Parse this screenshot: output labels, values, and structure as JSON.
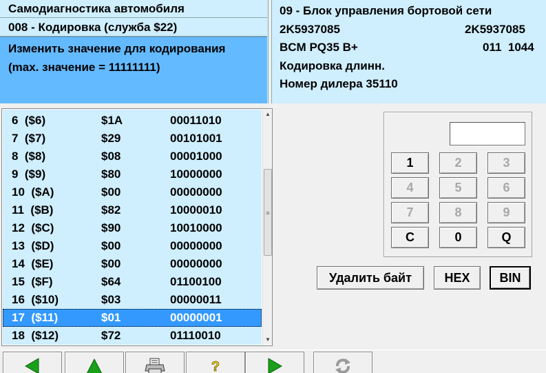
{
  "header_left": {
    "app_title": "Самодиагностика автомобиля",
    "function_title": "008 - Кодировка (служба $22)",
    "instruction_line1": "Изменить значение для кодирования",
    "instruction_line2": "(max. значение = 11111111)"
  },
  "header_right": {
    "module_title": "09 - Блок управления бортовой сети",
    "part_number_left": "2K5937085",
    "part_number_right": "2K5937085",
    "component": "BCM PQ35 B+",
    "version": "011  1044",
    "coding_type": "Кодировка длинн.",
    "dealer": "Номер дилера 35110"
  },
  "coding_list": {
    "rows": [
      {
        "index": "6  ($6)",
        "hex": "$1A",
        "bin": "00011010"
      },
      {
        "index": "7  ($7)",
        "hex": "$29",
        "bin": "00101001"
      },
      {
        "index": "8  ($8)",
        "hex": "$08",
        "bin": "00001000"
      },
      {
        "index": "9  ($9)",
        "hex": "$80",
        "bin": "10000000"
      },
      {
        "index": "10  ($A)",
        "hex": "$00",
        "bin": "00000000"
      },
      {
        "index": "11  ($B)",
        "hex": "$82",
        "bin": "10000010"
      },
      {
        "index": "12  ($C)",
        "hex": "$90",
        "bin": "10010000"
      },
      {
        "index": "13  ($D)",
        "hex": "$00",
        "bin": "00000000"
      },
      {
        "index": "14  ($E)",
        "hex": "$00",
        "bin": "00000000"
      },
      {
        "index": "15  ($F)",
        "hex": "$64",
        "bin": "01100100"
      },
      {
        "index": "16  ($10)",
        "hex": "$03",
        "bin": "00000011"
      },
      {
        "index": "17  ($11)",
        "hex": "$01",
        "bin": "00000001"
      },
      {
        "index": "18  ($12)",
        "hex": "$72",
        "bin": "01110010"
      }
    ],
    "selected_index": 11
  },
  "keypad": {
    "display_value": "",
    "keys": [
      {
        "label": "1",
        "enabled": true
      },
      {
        "label": "2",
        "enabled": false
      },
      {
        "label": "3",
        "enabled": false
      },
      {
        "label": "4",
        "enabled": false
      },
      {
        "label": "5",
        "enabled": false
      },
      {
        "label": "6",
        "enabled": false
      },
      {
        "label": "7",
        "enabled": false
      },
      {
        "label": "8",
        "enabled": false
      },
      {
        "label": "9",
        "enabled": false
      },
      {
        "label": "C",
        "enabled": true
      },
      {
        "label": "0",
        "enabled": true
      },
      {
        "label": "Q",
        "enabled": true
      }
    ]
  },
  "actions": {
    "delete_byte": "Удалить байт",
    "hex": "HEX",
    "bin": "BIN",
    "active_mode": "BIN"
  },
  "toolbar": {
    "buttons": [
      {
        "name": "back-button",
        "icon": "arrow-left-icon"
      },
      {
        "name": "up-button",
        "icon": "arrow-up-icon"
      },
      {
        "name": "print-button",
        "icon": "printer-icon"
      },
      {
        "name": "help-button",
        "icon": "help-icon"
      },
      {
        "name": "forward-button",
        "icon": "arrow-right-icon"
      },
      {
        "name": "refresh-button",
        "icon": "refresh-icon"
      }
    ]
  },
  "colors": {
    "panel_bg": "#cfeefe",
    "instruction_bg": "#64baff",
    "selection_bg": "#3399ff",
    "arrow_green": "#1aa01a",
    "help_yellow": "#f2d21a"
  }
}
